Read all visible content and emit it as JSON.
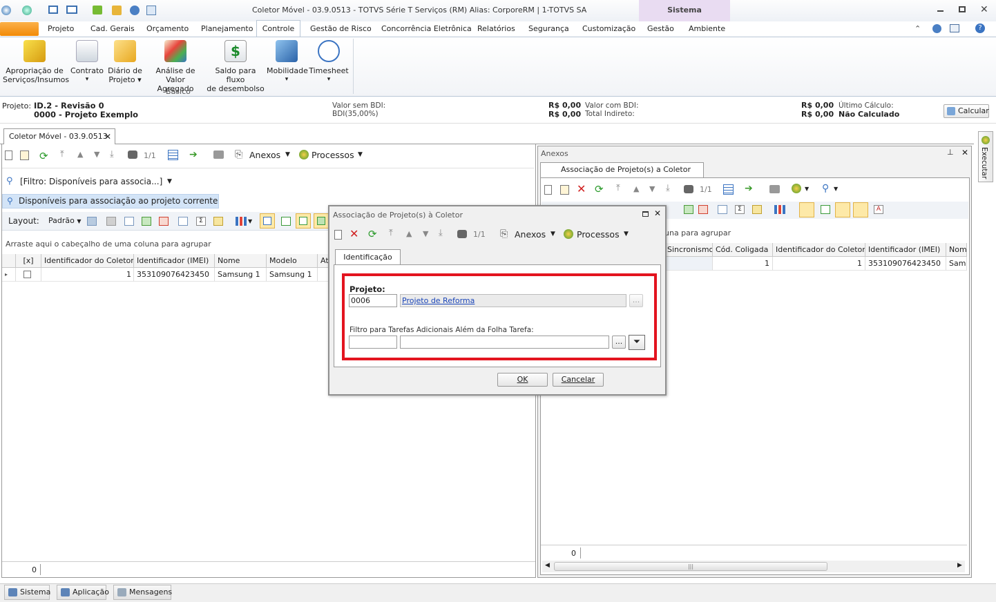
{
  "window": {
    "title": "Coletor Móvel - 03.9.0513 - TOTVS Série T Serviços (RM) Alias: CorporeRM | 1-TOTVS SA",
    "sistema_label": "Sistema"
  },
  "menu_tabs": [
    "Projeto",
    "Cad. Gerais",
    "Orçamento",
    "Planejamento",
    "Controle",
    "Gestão de Risco",
    "Concorrência Eletrônica",
    "Relatórios",
    "Segurança",
    "Customização",
    "Gestão",
    "Ambiente"
  ],
  "active_tab": "Controle",
  "ribbon": {
    "items": [
      {
        "line1": "Apropriação de",
        "line2": "Serviços/Insumos",
        "arrow": ""
      },
      {
        "line1": "Contrato",
        "line2": "",
        "arrow": "▾"
      },
      {
        "line1": "Diário de",
        "line2": "Projeto ▾",
        "arrow": ""
      },
      {
        "line1": "Análise de",
        "line2": "Valor Agregado",
        "arrow": ""
      },
      {
        "line1": "Saldo para fluxo",
        "line2": "de desembolso",
        "arrow": ""
      },
      {
        "line1": "Mobilidade",
        "line2": "",
        "arrow": "▾"
      },
      {
        "line1": "Timesheet",
        "line2": "",
        "arrow": "▾"
      }
    ],
    "group_label": "Básico"
  },
  "info": {
    "projeto_label": "Projeto:",
    "projeto_l1": "ID.2 - Revisão 0",
    "projeto_l2": "0000 - Projeto Exemplo",
    "valor_sem_bdi_label": "Valor sem BDI:",
    "bdi_label": "BDI(35,00%)",
    "valor1": "R$ 0,00",
    "valor2": "R$ 0,00",
    "valor_com_bdi_label": "Valor com BDI:",
    "total_indireto_label": "Total Indireto:",
    "valor3": "R$ 0,00",
    "valor4": "R$ 0,00",
    "ultimo_calculo_label": "Último Cálculo:",
    "nao_calculado": "Não Calculado",
    "calcular": "Calcular"
  },
  "doc_tab": "Coletor Móvel - 03.9.0513",
  "left_toolbar": {
    "page": "1/1",
    "anexos": "Anexos",
    "processos": "Processos"
  },
  "filter_label": "[Filtro: Disponíveis para associa...]",
  "view_label": "Disponíveis para associação ao projeto corrente",
  "layout": {
    "label": "Layout:",
    "padrao": "Padrão"
  },
  "group_hint": "Arraste aqui o cabeçalho de uma coluna para agrupar",
  "left_grid": {
    "headers": [
      "[x]",
      "Identificador do Coletor",
      "Identificador  (IMEI)",
      "Nome",
      "Modelo",
      "At"
    ],
    "row": [
      "",
      "1",
      "353109076423450",
      "Samsung 1",
      "Samsung 1",
      ""
    ],
    "footer_count": "0"
  },
  "right_panel": {
    "title": "Anexos",
    "tab": "Associação de  Projeto(s) a Coletor",
    "page": "1/1",
    "group_hint": "una para agrupar",
    "headers": [
      "Sincronismo",
      "Cód. Coligada",
      "Identificador do Coletor",
      "Identificador  (IMEI)",
      "Nome"
    ],
    "row": [
      "",
      "1",
      "1",
      "353109076423450",
      "Sams"
    ],
    "footer_count": "0"
  },
  "side_tab": "Executar",
  "dialog": {
    "title": "Associação de  Projeto(s) à Coletor",
    "page": "1/1",
    "anexos": "Anexos",
    "processos": "Processos",
    "tab": "Identificação",
    "projeto_label": "Projeto:",
    "projeto_code": "0006",
    "projeto_name": "Projeto de Reforma",
    "filtro_label": "Filtro para Tarefas Adicionais Além da Folha Tarefa:",
    "filtro_code": "",
    "filtro_name": "",
    "ellipsis": "...",
    "ok": "OK",
    "cancel": "Cancelar"
  },
  "statusbar": [
    "Sistema",
    "Aplicação",
    "Mensagens"
  ]
}
